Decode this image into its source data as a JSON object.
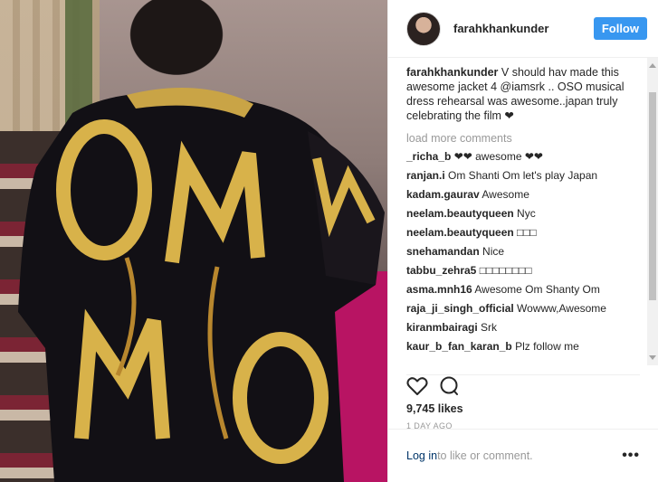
{
  "header": {
    "username": "farahkhankunder",
    "follow_label": "Follow"
  },
  "caption": {
    "username": "farahkhankunder",
    "text": " V should hav made this awesome jacket 4 @iamsrk .. OSO musical dress rehearsal was awesome..japan truly celebrating the film ❤"
  },
  "load_more": "load more comments",
  "comments": [
    {
      "user": "_richa_b",
      "text": " ❤❤ awesome ❤❤"
    },
    {
      "user": "ranjan.i",
      "text": " Om Shanti Om let's play Japan"
    },
    {
      "user": "kadam.gaurav",
      "text": " Awesome"
    },
    {
      "user": "neelam.beautyqueen",
      "text": " Nyc"
    },
    {
      "user": "neelam.beautyqueen",
      "text": " □□□"
    },
    {
      "user": "snehamandan",
      "text": " Nice"
    },
    {
      "user": "tabbu_zehra5",
      "text": " □□□□□□□□"
    },
    {
      "user": "asma.mnh16",
      "text": " Awesome Om Shanty Om"
    },
    {
      "user": "raja_ji_singh_official",
      "text": " Wowww,Awesome"
    },
    {
      "user": "kiranmbairagi",
      "text": " Srk"
    },
    {
      "user": "kaur_b_fan_karan_b",
      "text": " Plz follow me"
    }
  ],
  "likes": "9,745 likes",
  "date": "1 DAY AGO",
  "login": {
    "link": "Log in",
    "rest": " to like or comment.",
    "more": "•••"
  },
  "icons": {
    "like": "heart-icon",
    "comment": "comment-icon"
  },
  "colors": {
    "follow_bg": "#3897f0",
    "link": "#003569",
    "muted": "#999999"
  }
}
